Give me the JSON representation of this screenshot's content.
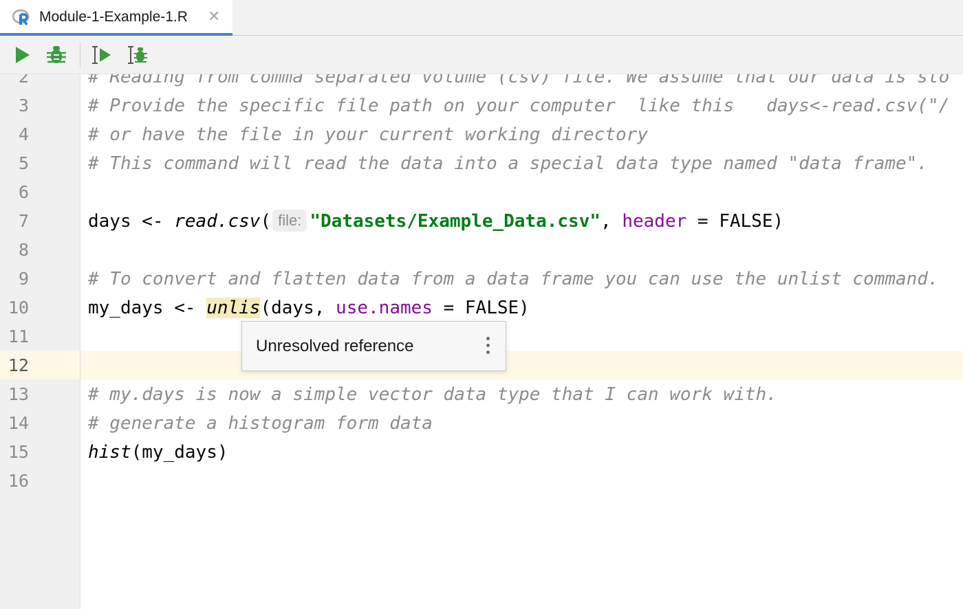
{
  "tab": {
    "title": "Module-1-Example-1.R",
    "close_glyph": "✕",
    "logo": "r-language-icon"
  },
  "toolbar": {
    "buttons": [
      "run-icon",
      "debug-icon",
      "run-selection-icon",
      "debug-selection-icon"
    ],
    "accent": "#3d9b3d"
  },
  "editor": {
    "line_numbers": [
      "2",
      "3",
      "4",
      "5",
      "6",
      "7",
      "8",
      "9",
      "10",
      "11",
      "12",
      "13",
      "14",
      "15",
      "16"
    ],
    "current_line": "12",
    "lines": {
      "l2": "# Reading from comma separated volume (csv) file. We assume that our data is sto",
      "l3": "# Provide the specific file path on your computer  like this   days<-read.csv(\"/",
      "l4": "# or have the file in your current working directory",
      "l5": "# This command will read the data into a special data type named \"data frame\".",
      "l7": {
        "t1": "days <- ",
        "fn": "read.csv",
        "t2": "(",
        "hint": "file:",
        "str": "\"Datasets/Example_Data.csv\"",
        "t3": ", ",
        "param": "header",
        "t4": " = FALSE)"
      },
      "l9": "# To convert and flatten data from a data frame you can use the unlist command.",
      "l10": {
        "t1": "my_days <- ",
        "fn": "unlis",
        "t2": "(days, ",
        "param": "use.names",
        "t3": " = FALSE)"
      },
      "l13": "# my.days is now a simple vector data type that I can work with.",
      "l14": "# generate a histogram form data",
      "l15": {
        "fn": "hist",
        "t1": "(my_days)"
      }
    }
  },
  "popup": {
    "message": "Unresolved reference",
    "more_icon": "more-vertical-icon"
  },
  "colors": {
    "comment": "#8c8c8c",
    "string": "#067d17",
    "parameter": "#871094",
    "current_line": "#fdf9e6",
    "unresolved_highlight": "#f6ebbc",
    "tab_underline": "#4a83c8"
  }
}
